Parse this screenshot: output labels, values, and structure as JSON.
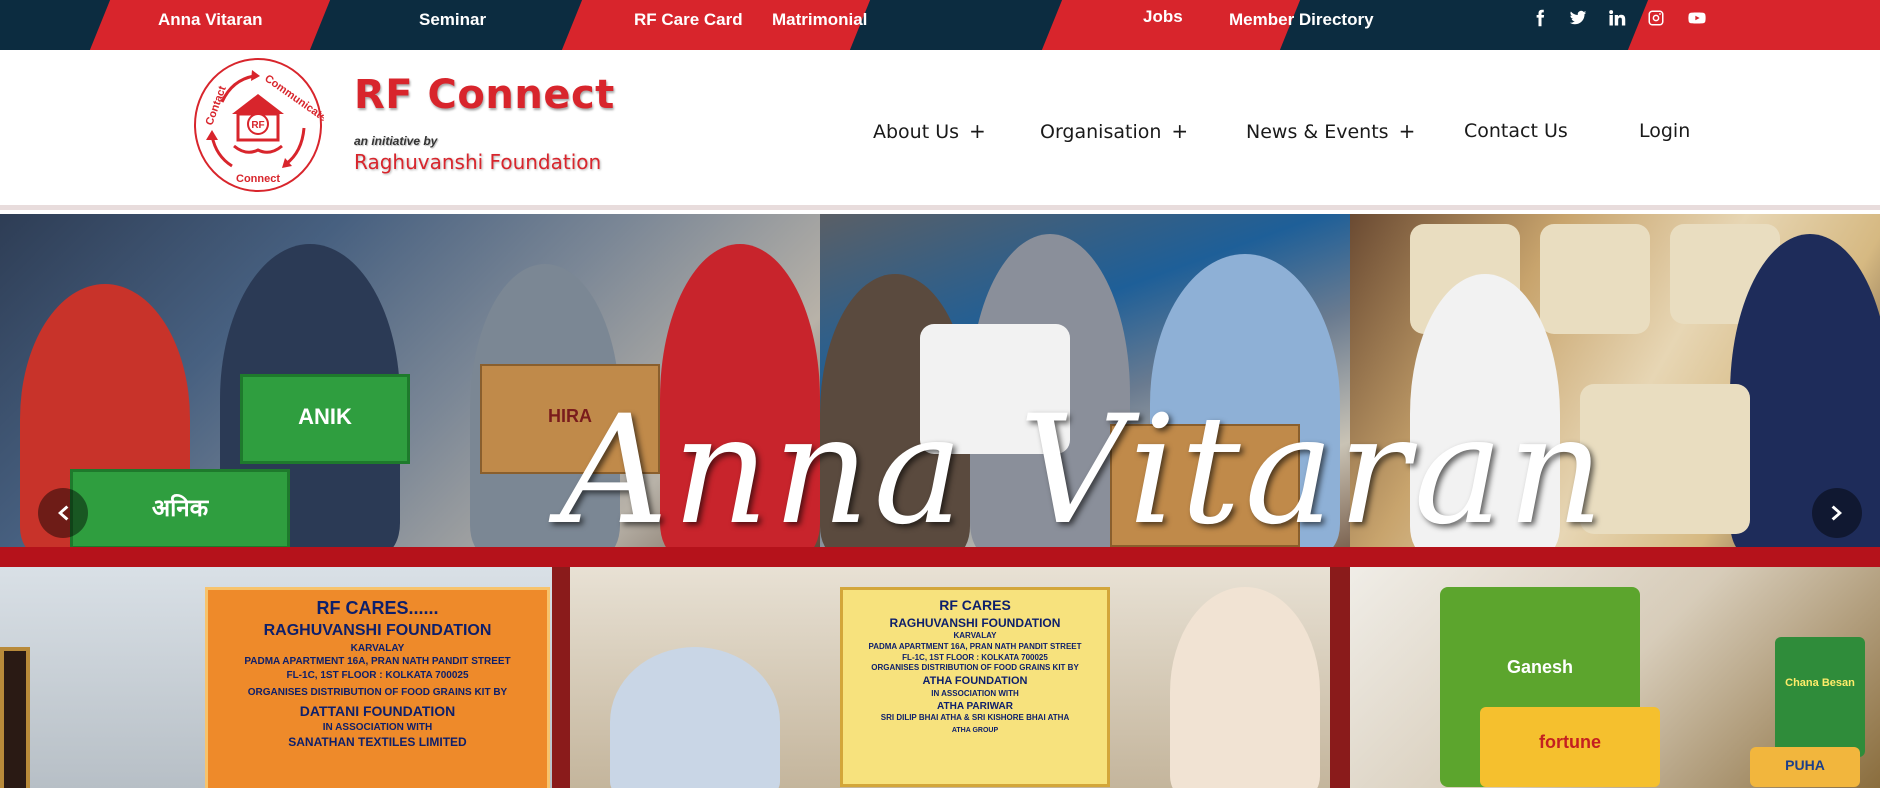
{
  "topbar": {
    "links": [
      "Anna Vitaran",
      "Seminar",
      "RF Care Card",
      "Matrimonial",
      "Jobs",
      "Member Directory"
    ],
    "social_icons": [
      "facebook-icon",
      "twitter-icon",
      "linkedin-icon",
      "instagram-icon",
      "youtube-icon"
    ],
    "colors": {
      "navy": "#0c2c40",
      "red": "#d8252c"
    }
  },
  "logo": {
    "emblem_words": [
      "Contact",
      "Communicate",
      "Connect"
    ],
    "emblem_initials": "RF",
    "title": "RF Connect",
    "tagline": "an initiative by",
    "foundation": "Raghuvanshi Foundation"
  },
  "nav": {
    "items": [
      {
        "label": "About Us",
        "has_submenu": true
      },
      {
        "label": "Organisation",
        "has_submenu": true
      },
      {
        "label": "News & Events",
        "has_submenu": true
      },
      {
        "label": "Contact Us",
        "has_submenu": false
      },
      {
        "label": "Login",
        "has_submenu": false
      }
    ],
    "submenu_symbol": "+"
  },
  "hero": {
    "title": "Anna Vitaran",
    "prev_icon": "chevron-left-icon",
    "next_icon": "chevron-right-icon",
    "box_labels": [
      "ANIK",
      "अनिक",
      "HIRA"
    ],
    "banner_left": {
      "heading": "RF CARES......",
      "org": "RAGHUVANSHI FOUNDATION",
      "sub": "KARVALAY",
      "address1": "PADMA APARTMENT 16A, PRAN NATH PANDIT STREET",
      "address2": "FL-1C, 1ST FLOOR : KOLKATA 700025",
      "line1": "ORGANISES DISTRIBUTION OF FOOD GRAINS KIT BY",
      "partner": "DATTANI FOUNDATION",
      "assoc": "IN ASSOCIATION WITH",
      "assoc_org": "SANATHAN TEXTILES LIMITED"
    },
    "banner_center": {
      "heading": "RF CARES",
      "org": "RAGHUVANSHI FOUNDATION",
      "sub": "KARVALAY",
      "address1": "PADMA APARTMENT 16A, PRAN NATH PANDIT STREET",
      "address2": "FL-1C, 1ST FLOOR : KOLKATA 700025",
      "line1": "ORGANISES DISTRIBUTION OF FOOD GRAINS KIT BY",
      "partner": "ATHA FOUNDATION",
      "assoc": "IN ASSOCIATION WITH",
      "assoc_org": "ATHA PARIWAR",
      "footer": "SRI DILIP BHAI ATHA & SRI KISHORE BHAI ATHA",
      "logo_text": "ATHA GROUP"
    },
    "pack_labels": [
      "Ganesh",
      "Chana Besan",
      "PUHA",
      "fortune"
    ]
  }
}
